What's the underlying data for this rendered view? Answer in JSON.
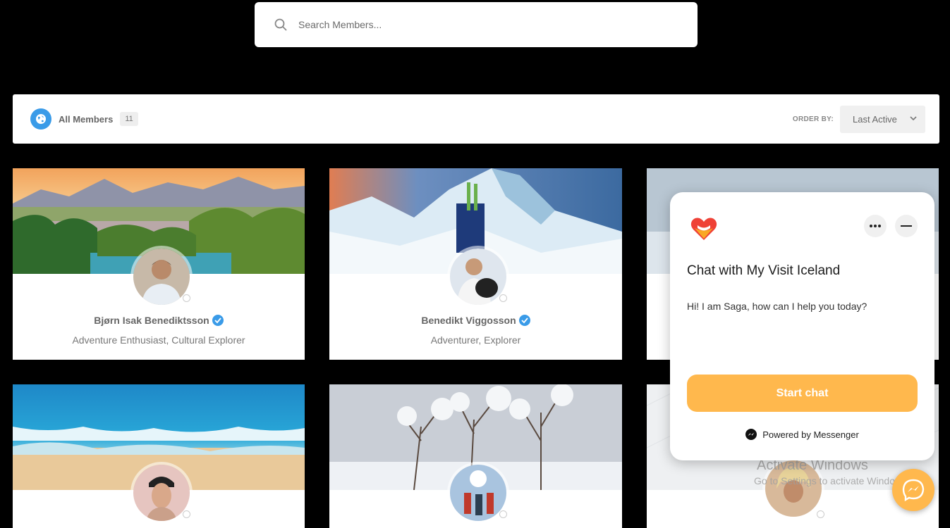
{
  "search": {
    "placeholder": "Search Members..."
  },
  "filter": {
    "label": "All Members",
    "count": "11",
    "order_label": "ORDER BY:",
    "order_value": "Last Active"
  },
  "members": [
    {
      "name": "Bjørn Isak Benediktsson",
      "role": "Adventure Enthusiast, Cultural Explorer",
      "verified": true
    },
    {
      "name": "Benedikt Viggosson",
      "role": "Adventurer, Explorer",
      "verified": true
    }
  ],
  "chat": {
    "title": "Chat with My Visit Iceland",
    "message": "Hi! I am Saga, how can I help you today?",
    "start_button": "Start chat",
    "powered_by": "Powered by Messenger"
  },
  "watermark": {
    "title": "Activate Windows",
    "subtitle": "Go to Settings to activate Windows."
  },
  "colors": {
    "accent_blue": "#3a9be8",
    "chat_orange": "#ffb84d",
    "background": "#000000"
  },
  "icons": [
    "search-icon",
    "globe-icon",
    "chevron-down-icon",
    "verified-icon",
    "more-icon",
    "minimize-icon",
    "messenger-icon",
    "heart-logo-icon"
  ]
}
